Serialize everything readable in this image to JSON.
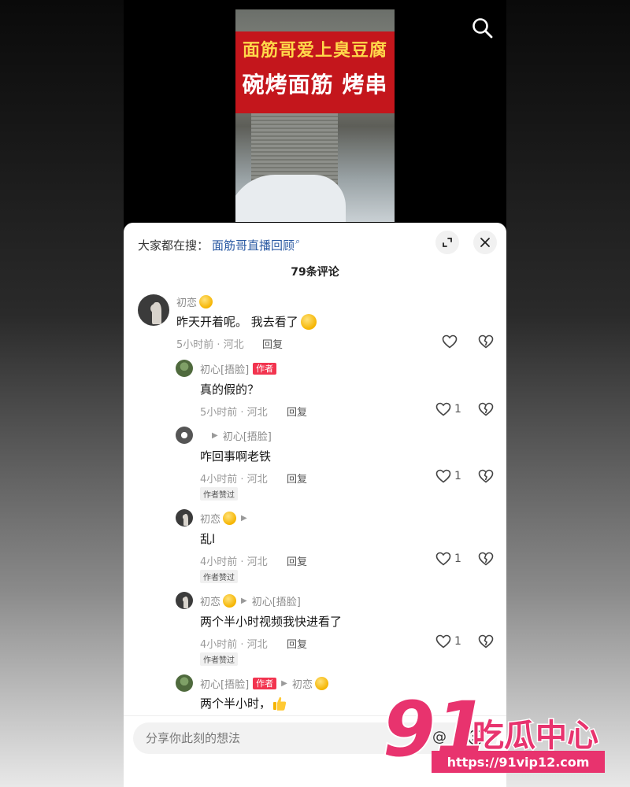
{
  "video": {
    "sign_line1": "面筋哥爱上臭豆腐",
    "sign_line2": "碗烤面筋 烤串"
  },
  "header": {
    "search_prefix": "大家都在搜：",
    "search_term": "面筋哥直播回顾",
    "comment_count": "79条评论"
  },
  "comments": [
    {
      "user": "初恋",
      "text": "昨天开着呢。 我去看了",
      "time": "5小时前 · 河北",
      "reply_label": "回复",
      "likes": ""
    },
    {
      "user": "初心[捂脸]",
      "author_tag": "作者",
      "text": "真的假的？",
      "time": "5小时前 · 河北",
      "reply_label": "回复",
      "likes": "1"
    },
    {
      "user": "",
      "reply_to": "初心[捂脸]",
      "text": "咋回事啊老铁",
      "time": "4小时前 · 河北",
      "reply_label": "回复",
      "likes": "1",
      "badge": "作者赞过"
    },
    {
      "user": "初恋",
      "text": "乱l",
      "time": "4小时前 · 河北",
      "reply_label": "回复",
      "likes": "1",
      "badge": "作者赞过"
    },
    {
      "user": "初恋",
      "reply_to": "初心[捂脸]",
      "text": "两个半小时视频我快进看了",
      "time": "4小时前 · 河北",
      "reply_label": "回复",
      "likes": "1",
      "badge": "作者赞过"
    },
    {
      "user": "初心[捂脸]",
      "author_tag": "作者",
      "reply_to": "初恋",
      "text": "两个半小时，"
    }
  ],
  "input": {
    "placeholder": "分享你此刻的想法"
  },
  "watermark": {
    "logo_number": "91",
    "logo_text": "吃瓜中心",
    "url": "https://91vip12.com"
  },
  "colors": {
    "author_tag": "#f2344f",
    "link": "#2b5aa3",
    "watermark_pink": "#e8336e"
  }
}
